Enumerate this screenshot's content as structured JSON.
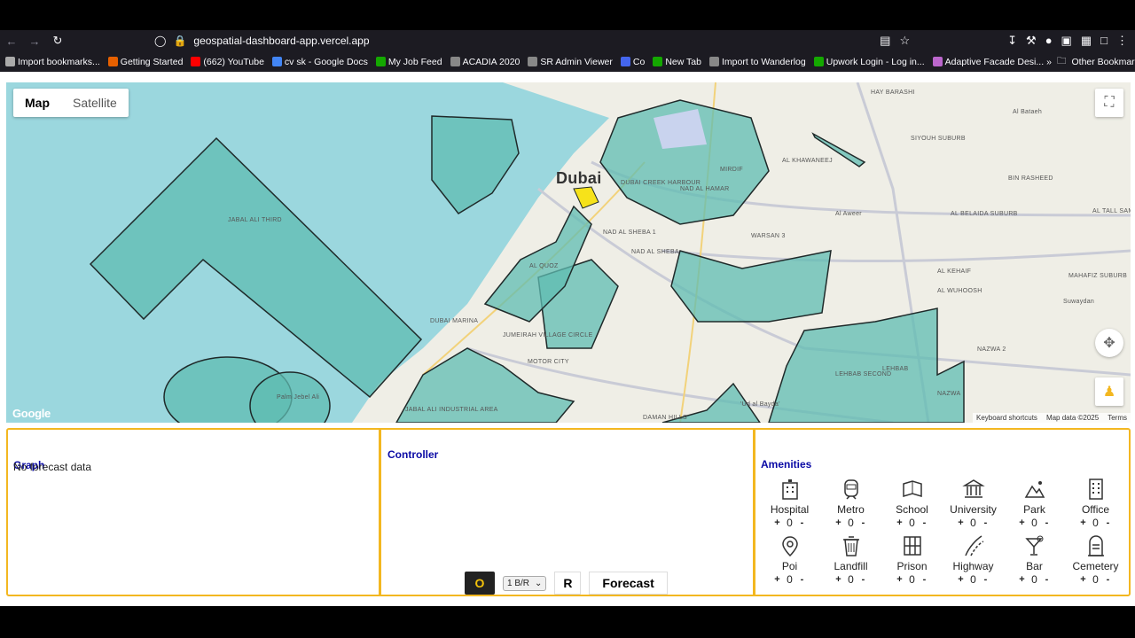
{
  "browser": {
    "url": "geospatial-dashboard-app.vercel.app",
    "bookmarks": [
      {
        "label": "Import bookmarks...",
        "color": "#aaaaaa"
      },
      {
        "label": "Getting Started",
        "color": "#e66000"
      },
      {
        "label": "(662) YouTube",
        "color": "#ff0000"
      },
      {
        "label": "cv sk - Google Docs",
        "color": "#4285f4"
      },
      {
        "label": "My Job Feed",
        "color": "#14a800"
      },
      {
        "label": "ACADIA 2020",
        "color": "#888888"
      },
      {
        "label": "SR Admin Viewer",
        "color": "#888888"
      },
      {
        "label": "Co",
        "color": "#4466ee"
      },
      {
        "label": "New Tab",
        "color": "#14a800"
      },
      {
        "label": "Import to Wanderlog",
        "color": "#888888"
      },
      {
        "label": "Upwork Login - Log in...",
        "color": "#14a800"
      },
      {
        "label": "Adaptive Facade Desi...",
        "color": "#bb66cc"
      }
    ],
    "other_bookmarks": "Other Bookmarks"
  },
  "map": {
    "type_map": "Map",
    "type_satellite": "Satellite",
    "selected_type": "Map",
    "city_label": "Dubai",
    "labels": [
      "HAY BARASHI",
      "Al Bataeh",
      "SIYOUH SUBURB",
      "AL KHAWANEEJ",
      "BIN RASHEED",
      "JABAL ALI THIRD",
      "MIRDIF",
      "Al Aweer",
      "AL BELAIDA SUBURB",
      "AL TALL SAMAN",
      "DUBAI CREEK HARBOUR",
      "NAD AL HAMAR",
      "WARSAN 3",
      "NAD AL SHEBA 1",
      "NAD AL SHEBA",
      "AL QUOZ",
      "AL KEHAIF",
      "AL WUHOOSH",
      "MAHAFIZ SUBURB",
      "Suwaydan",
      "DUBAI MARINA",
      "JUMEIRAH VILLAGE CIRCLE",
      "MOTOR CITY",
      "NAZWA 2",
      "LEHBAB SECOND",
      "LEHBAB",
      "NAZWA",
      "Palm Jebel Ali",
      "JABAL ALI INDUSTRIAL AREA",
      "DAMAN HILLS",
      "'Ud al Bayda'"
    ],
    "google": "Google",
    "attribution": [
      "Keyboard shortcuts",
      "Map data ©2025",
      "Terms"
    ]
  },
  "graph": {
    "title": "Graph",
    "message": "No forecast data"
  },
  "controller": {
    "title": "Controller",
    "btn_o": "O",
    "bedroom_select": "1 B/R",
    "btn_r": "R",
    "btn_forecast": "Forecast"
  },
  "amenities": {
    "title": "Amenities",
    "items": [
      {
        "label": "Hospital",
        "count": "0",
        "icon": "hospital-icon"
      },
      {
        "label": "Metro",
        "count": "0",
        "icon": "metro-icon"
      },
      {
        "label": "School",
        "count": "0",
        "icon": "school-icon"
      },
      {
        "label": "University",
        "count": "0",
        "icon": "university-icon"
      },
      {
        "label": "Park",
        "count": "0",
        "icon": "park-icon"
      },
      {
        "label": "Office",
        "count": "0",
        "icon": "office-icon"
      },
      {
        "label": "Poi",
        "count": "0",
        "icon": "poi-icon"
      },
      {
        "label": "Landfill",
        "count": "0",
        "icon": "landfill-icon"
      },
      {
        "label": "Prison",
        "count": "0",
        "icon": "prison-icon"
      },
      {
        "label": "Highway",
        "count": "0",
        "icon": "highway-icon"
      },
      {
        "label": "Bar",
        "count": "0",
        "icon": "bar-icon"
      },
      {
        "label": "Cemetery",
        "count": "0",
        "icon": "cemetery-icon"
      }
    ],
    "plus": "+",
    "minus": "-"
  },
  "colors": {
    "accent_border": "#f3b720",
    "title_blue": "#0a0aa5",
    "zone_fill": "#5fbcb2",
    "highlight_zone": "#f6e21a",
    "sea": "#9bd7de",
    "land": "#efeee6"
  }
}
